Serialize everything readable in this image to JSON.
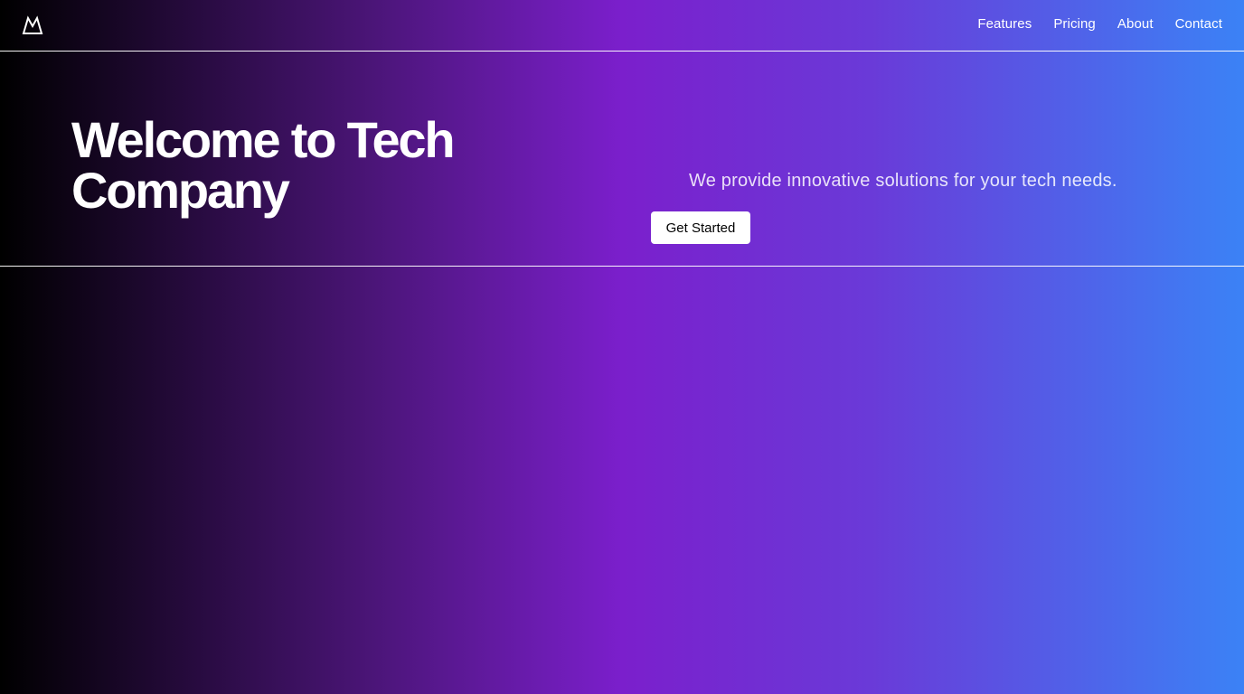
{
  "nav": {
    "logo_icon": "mountain-logo-icon",
    "items": [
      {
        "label": "Features"
      },
      {
        "label": "Pricing"
      },
      {
        "label": "About"
      },
      {
        "label": "Contact"
      }
    ]
  },
  "hero": {
    "title": "Welcome to Tech Company",
    "subtitle": "We provide innovative solutions for your tech needs.",
    "cta_label": "Get Started"
  },
  "colors": {
    "gradient_start": "#000000",
    "gradient_mid": "#7b1fcc",
    "gradient_end": "#3b82f6",
    "button_bg": "#ffffff",
    "button_text": "#000000"
  }
}
